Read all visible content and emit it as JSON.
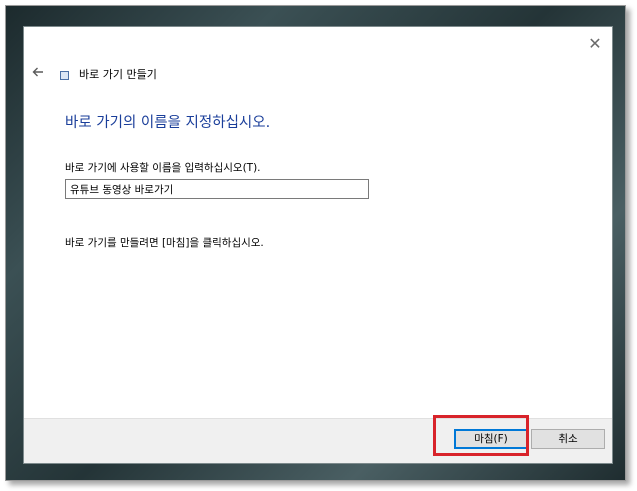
{
  "wizard": {
    "title": "바로 가기 만들기",
    "close_glyph": "✕",
    "main_instruction": "바로 가기의 이름을 지정하십시오.",
    "name_label": "바로 가기에 사용할 이름을 입력하십시오(T).",
    "name_value": "유튜브 동영상 바로가기",
    "hint": "바로 가기를 만들려면 [마침]을 클릭하십시오."
  },
  "buttons": {
    "finish_label": "마침(F)",
    "cancel_label": "취소"
  },
  "icons": {
    "back": "back-arrow-icon",
    "close": "close-icon",
    "wizard": "shortcut-wizard-icon"
  },
  "colors": {
    "instruction": "#1a3e9a",
    "highlight": "#d8232a",
    "default_button_border": "#0078d7"
  }
}
